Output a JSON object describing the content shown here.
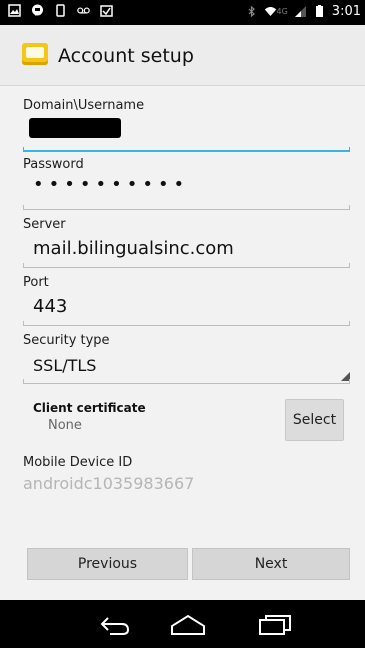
{
  "status_bar": {
    "time": "3:01",
    "network": "4G",
    "icons": [
      "image-icon",
      "messenger-icon",
      "phone-icon",
      "voicemail-icon",
      "calendar-check-icon",
      "bluetooth-icon",
      "wifi-icon",
      "signal-icon",
      "battery-icon"
    ]
  },
  "action_bar": {
    "title": "Account setup",
    "icon": "email-app-icon"
  },
  "form": {
    "username": {
      "label": "Domain\\Username",
      "value": ""
    },
    "password": {
      "label": "Password",
      "value": "••••••••••"
    },
    "server": {
      "label": "Server",
      "value": "mail.bilingualsinc.com"
    },
    "port": {
      "label": "Port",
      "value": "443"
    },
    "security": {
      "label": "Security type",
      "value": "SSL/TLS"
    },
    "client_certificate": {
      "label": "Client certificate",
      "value": "None",
      "button": "Select"
    },
    "mobile_device_id": {
      "label": "Mobile Device ID",
      "value": "androidc1035983667"
    }
  },
  "buttons": {
    "previous": "Previous",
    "next": "Next"
  },
  "nav_bar": [
    "back-icon",
    "home-icon",
    "recents-icon"
  ],
  "colors": {
    "accent": "#33b5e5",
    "background": "#f2f2f2"
  }
}
